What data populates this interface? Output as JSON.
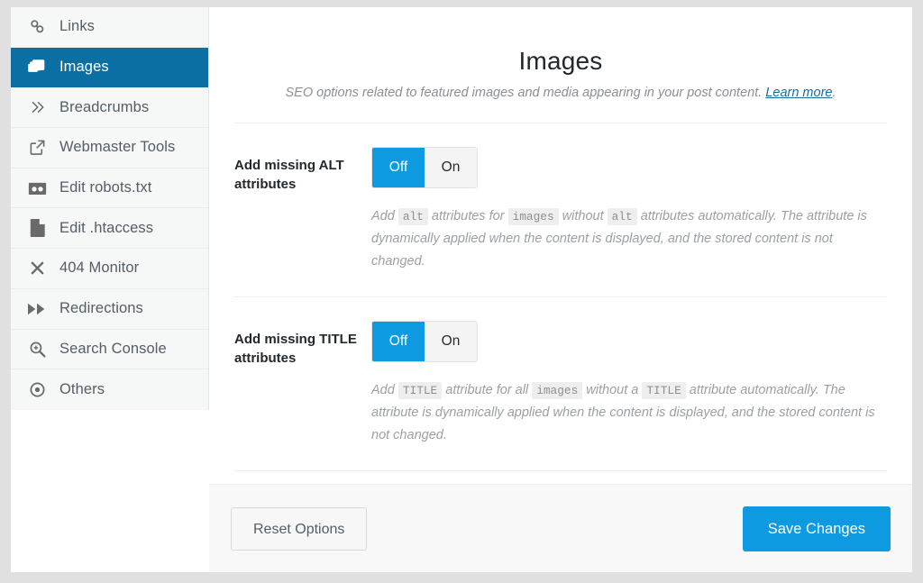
{
  "sidebar": {
    "items": [
      {
        "label": "Links",
        "icon": "links-icon",
        "active": false
      },
      {
        "label": "Images",
        "icon": "images-icon",
        "active": true
      },
      {
        "label": "Breadcrumbs",
        "icon": "chevrons-right-icon",
        "active": false
      },
      {
        "label": "Webmaster Tools",
        "icon": "external-link-icon",
        "active": false
      },
      {
        "label": "Edit robots.txt",
        "icon": "robot-icon",
        "active": false
      },
      {
        "label": "Edit .htaccess",
        "icon": "document-icon",
        "active": false
      },
      {
        "label": "404 Monitor",
        "icon": "close-x-icon",
        "active": false
      },
      {
        "label": "Redirections",
        "icon": "fast-forward-icon",
        "active": false
      },
      {
        "label": "Search Console",
        "icon": "search-plus-icon",
        "active": false
      },
      {
        "label": "Others",
        "icon": "target-dot-icon",
        "active": false
      }
    ]
  },
  "panel": {
    "title": "Images",
    "subtitle_before": "SEO options related to featured images and media appearing in your post content. ",
    "subtitle_link": "Learn more",
    "subtitle_after": "."
  },
  "settings": [
    {
      "label": "Add missing ALT attributes",
      "toggle": {
        "off_label": "Off",
        "on_label": "On",
        "value": "Off"
      },
      "description": [
        {
          "t": "Add ",
          "code": false
        },
        {
          "t": "alt",
          "code": true
        },
        {
          "t": " attributes for ",
          "code": false
        },
        {
          "t": "images",
          "code": true
        },
        {
          "t": " without ",
          "code": false
        },
        {
          "t": "alt",
          "code": true
        },
        {
          "t": " attributes automatically. The attribute is dynamically applied when the content is displayed, and the stored content is not changed.",
          "code": false
        }
      ]
    },
    {
      "label": "Add missing TITLE attributes",
      "toggle": {
        "off_label": "Off",
        "on_label": "On",
        "value": "Off"
      },
      "description": [
        {
          "t": "Add ",
          "code": false
        },
        {
          "t": "TITLE",
          "code": true
        },
        {
          "t": " attribute for all ",
          "code": false
        },
        {
          "t": "images",
          "code": true
        },
        {
          "t": " without a ",
          "code": false
        },
        {
          "t": "TITLE",
          "code": true
        },
        {
          "t": " attribute automatically. The attribute is dynamically applied when the content is displayed, and the stored content is not changed.",
          "code": false
        }
      ]
    }
  ],
  "footer": {
    "reset_label": "Reset Options",
    "save_label": "Save Changes"
  },
  "colors": {
    "sidebar_active": "#0b6fa4",
    "accent_blue": "#0e9ae0",
    "link_blue": "#1c6a9e",
    "page_bg": "#e0e0e0",
    "card_bg": "#ffffff",
    "sidebar_bg": "#f6f7f7",
    "footer_bg": "#f8f8f8"
  }
}
